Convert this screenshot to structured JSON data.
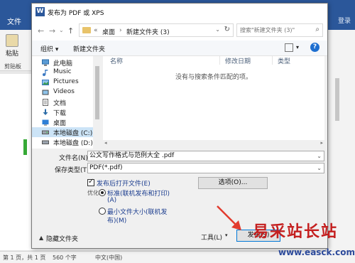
{
  "word": {
    "file_tab": "文件",
    "tabs_right": "登录",
    "paste_label": "粘贴",
    "clipboard_label": "剪贴板",
    "status": {
      "page": "第 1 页，共 1 页",
      "words": "560 个字",
      "lang": "中文(中国)"
    }
  },
  "dialog": {
    "title": "发布为 PDF 或 XPS",
    "breadcrumb": [
      "«",
      "桌面",
      "›",
      "新建文件夹 (3)"
    ],
    "search_placeholder": "搜索\"新建文件夹 (3)\"",
    "toolbar": {
      "organize": "组织 ▾",
      "new_folder": "新建文件夹"
    },
    "nav_items": [
      {
        "label": "此电脑",
        "icon": "pc-icon"
      },
      {
        "label": "Music",
        "icon": "music-icon"
      },
      {
        "label": "Pictures",
        "icon": "pictures-icon"
      },
      {
        "label": "Videos",
        "icon": "videos-icon"
      },
      {
        "label": "文档",
        "icon": "documents-icon"
      },
      {
        "label": "下载",
        "icon": "download-icon"
      },
      {
        "label": "桌面",
        "icon": "desktop-icon"
      },
      {
        "label": "本地磁盘 (C:)",
        "icon": "drive-icon",
        "selected": true
      },
      {
        "label": "本地磁盘 (D:)",
        "icon": "drive-icon"
      }
    ],
    "columns": [
      "名称",
      "修改日期",
      "类型"
    ],
    "empty_message": "没有与搜索条件匹配的项。",
    "filename_label": "文件名(N):",
    "filename_value": "公文写作格式与范例大全 .pdf",
    "filetype_label": "保存类型(T):",
    "filetype_value": "PDF(*.pdf)",
    "open_after_publish": "发布后打开文件(E)",
    "optimize_label": "优化:",
    "optimize_standard_1": "标准(联机发布和打印)",
    "optimize_standard_2": "(A)",
    "optimize_min_1": "最小文件大小(联机发",
    "optimize_min_2": "布)(M)",
    "options_button": "选项(O)...",
    "hide_folders": "隐藏文件夹",
    "tools_button": "工具(L)",
    "publish_button": "发布(S)"
  },
  "watermark": {
    "cn": "易采站长站",
    "url": "www.easck.com"
  },
  "colors": {
    "word_blue": "#2b579a",
    "selected_bg": "#cce4f7",
    "red_arrow": "#e23b2e"
  }
}
